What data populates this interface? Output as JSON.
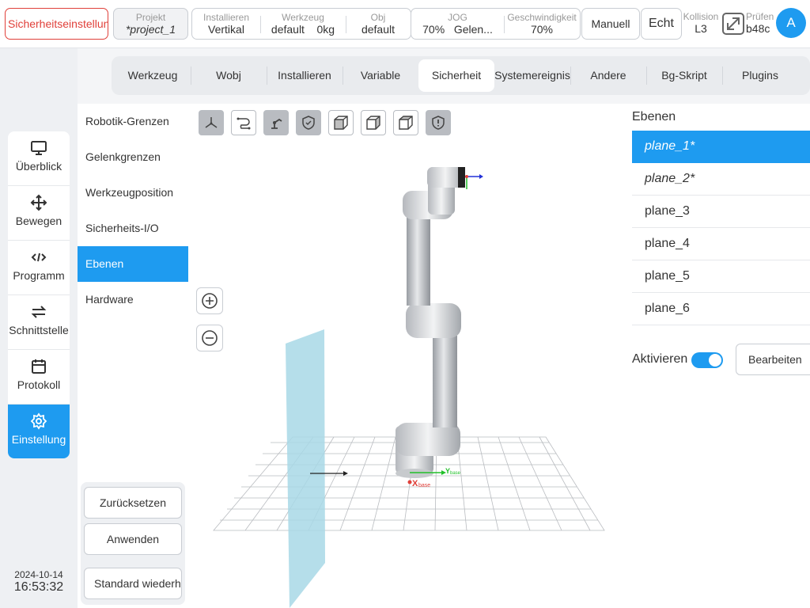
{
  "topbar": {
    "safety_button": "Sicherheitseinstellung",
    "project": {
      "label": "Projekt",
      "value": "*project_1"
    },
    "install": {
      "label": "Installieren",
      "value": "Vertikal"
    },
    "tool": {
      "label": "Werkzeug",
      "value": "default",
      "extra": "0kg"
    },
    "obj": {
      "label": "Obj",
      "value": "default"
    },
    "jog": {
      "label": "JOG",
      "value": "70%",
      "mode": "Gelen..."
    },
    "speed": {
      "label": "Geschwindigkeit",
      "value": "70%"
    },
    "manual_button": "Manuell",
    "real_button": "Echt",
    "collision": {
      "label": "Kollision",
      "value": "L3"
    },
    "check": {
      "label": "Prüfen",
      "value": "b48c"
    },
    "avatar_initial": "A"
  },
  "nav": {
    "items": [
      {
        "label": "Überblick",
        "icon": "monitor-icon"
      },
      {
        "label": "Bewegen",
        "icon": "move-arrows-icon"
      },
      {
        "label": "Programm",
        "icon": "code-icon"
      },
      {
        "label": "Schnittstelle",
        "icon": "swap-arrows-icon"
      },
      {
        "label": "Protokoll",
        "icon": "calendar-icon"
      },
      {
        "label": "Einstellung",
        "icon": "gear-icon"
      }
    ],
    "active_index": 5,
    "date": "2024-10-14",
    "time": "16:53:32"
  },
  "tabs": {
    "items": [
      "Werkzeug",
      "Wobj",
      "Installieren",
      "Variable",
      "Sicherheit",
      "Systemereignis",
      "Andere",
      "Bg-Skript",
      "Plugins"
    ],
    "active_index": 4
  },
  "submenu": {
    "items": [
      "Robotik-Grenzen",
      "Gelenkgrenzen",
      "Werkzeugposition",
      "Sicherheits-I/O",
      "Ebenen",
      "Hardware"
    ],
    "active_index": 4,
    "reset_button": "Zurücksetzen",
    "apply_button": "Anwenden",
    "restore_button": "Standard wiederherstellen"
  },
  "viewport": {
    "tool_icons": [
      "axes-view-icon",
      "path-view-icon",
      "robot-view-icon",
      "shield-check-icon",
      "cube-front-icon",
      "cube-side-icon",
      "cube-iso-icon",
      "shield-alert-icon"
    ],
    "zoom_in_icon": "zoom-in-icon",
    "zoom_out_icon": "zoom-out-icon",
    "axis_x_label": "X",
    "axis_x_sub": "base",
    "axis_y_label": "Y",
    "axis_y_sub": "base"
  },
  "planes": {
    "title": "Ebenen",
    "items": [
      "plane_1*",
      "plane_2*",
      "plane_3",
      "plane_4",
      "plane_5",
      "plane_6"
    ],
    "active_index": 0,
    "activate_label": "Aktivieren",
    "activate_on": true,
    "edit_button": "Bearbeiten"
  },
  "colors": {
    "accent": "#1e9bf0",
    "danger": "#e0403a",
    "plane_fill": "#a8d8e6"
  }
}
